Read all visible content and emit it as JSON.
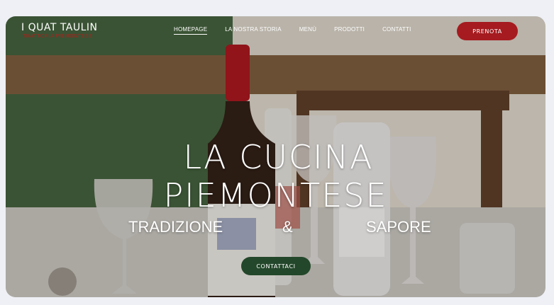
{
  "logo": {
    "name": "I QUAT TAULIN",
    "subtitle": "TRATTORIA PIEMONTESE"
  },
  "nav": {
    "items": [
      {
        "label": "HOMEPAGE",
        "active": true
      },
      {
        "label": "LA NOSTRA STORIA",
        "active": false
      },
      {
        "label": "MENÙ",
        "active": false
      },
      {
        "label": "PRODOTTI",
        "active": false
      },
      {
        "label": "CONTATTI",
        "active": false
      }
    ],
    "cta_label": "PRENOTA"
  },
  "hero": {
    "title_line1": "LA CUCINA",
    "title_line2": "PIEMONTESE",
    "subtitle": {
      "word1": "TRADIZIONE",
      "word2": "&",
      "word3": "SAPORE"
    },
    "cta_label": "CONTATTACI"
  },
  "colors": {
    "prenota_bg": "#a51b1f",
    "contattaci_bg": "#23472a",
    "logo_subtitle": "#b0201c",
    "page_bg": "#eef0f5"
  }
}
